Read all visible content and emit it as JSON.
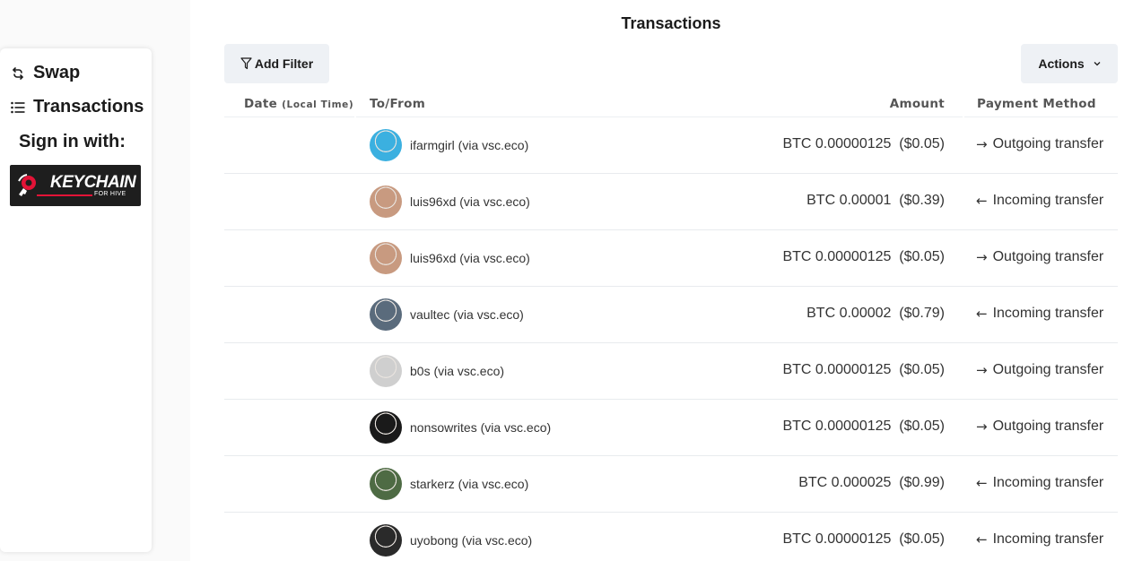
{
  "sidebar": {
    "items": [
      {
        "label": "Swap",
        "icon": "swap-icon"
      },
      {
        "label": "Transactions",
        "icon": "list-icon"
      }
    ],
    "sign_in_label": "Sign in with:",
    "keychain": {
      "text": "KEYCHAIN",
      "subtext": "FOR HIVE",
      "icon": "key-icon"
    }
  },
  "main": {
    "title": "Transactions",
    "filter_button": "Add Filter",
    "actions_button": "Actions",
    "table": {
      "headers": {
        "date": "Date",
        "date_note": "(Local Time)",
        "to_from": "To/From",
        "amount": "Amount",
        "payment_method": "Payment Method"
      },
      "rows": [
        {
          "account": "ifarmgirl (via vsc.eco)",
          "amount": "BTC 0.00000125  ($0.05)",
          "method": "Outgoing transfer",
          "direction": "out",
          "avatar_color": "#3bb0e0"
        },
        {
          "account": "luis96xd (via vsc.eco)",
          "amount": "BTC 0.00001  ($0.39)",
          "method": "Incoming transfer",
          "direction": "in",
          "avatar_color": "#c89a80"
        },
        {
          "account": "luis96xd (via vsc.eco)",
          "amount": "BTC 0.00000125  ($0.05)",
          "method": "Outgoing transfer",
          "direction": "out",
          "avatar_color": "#c89a80"
        },
        {
          "account": "vaultec (via vsc.eco)",
          "amount": "BTC 0.00002  ($0.79)",
          "method": "Incoming transfer",
          "direction": "in",
          "avatar_color": "#5a6b7c"
        },
        {
          "account": "b0s (via vsc.eco)",
          "amount": "BTC 0.00000125  ($0.05)",
          "method": "Outgoing transfer",
          "direction": "out",
          "avatar_color": "#cfcfcf"
        },
        {
          "account": "nonsowrites (via vsc.eco)",
          "amount": "BTC 0.00000125  ($0.05)",
          "method": "Outgoing transfer",
          "direction": "out",
          "avatar_color": "#1a1a1a"
        },
        {
          "account": "starkerz (via vsc.eco)",
          "amount": "BTC 0.000025  ($0.99)",
          "method": "Incoming transfer",
          "direction": "in",
          "avatar_color": "#4e6b44"
        },
        {
          "account": "uyobong (via vsc.eco)",
          "amount": "BTC 0.00000125  ($0.05)",
          "method": "Incoming transfer",
          "direction": "in",
          "avatar_color": "#2a2a2a"
        }
      ]
    }
  },
  "arrows": {
    "out": "→",
    "in": "←"
  }
}
